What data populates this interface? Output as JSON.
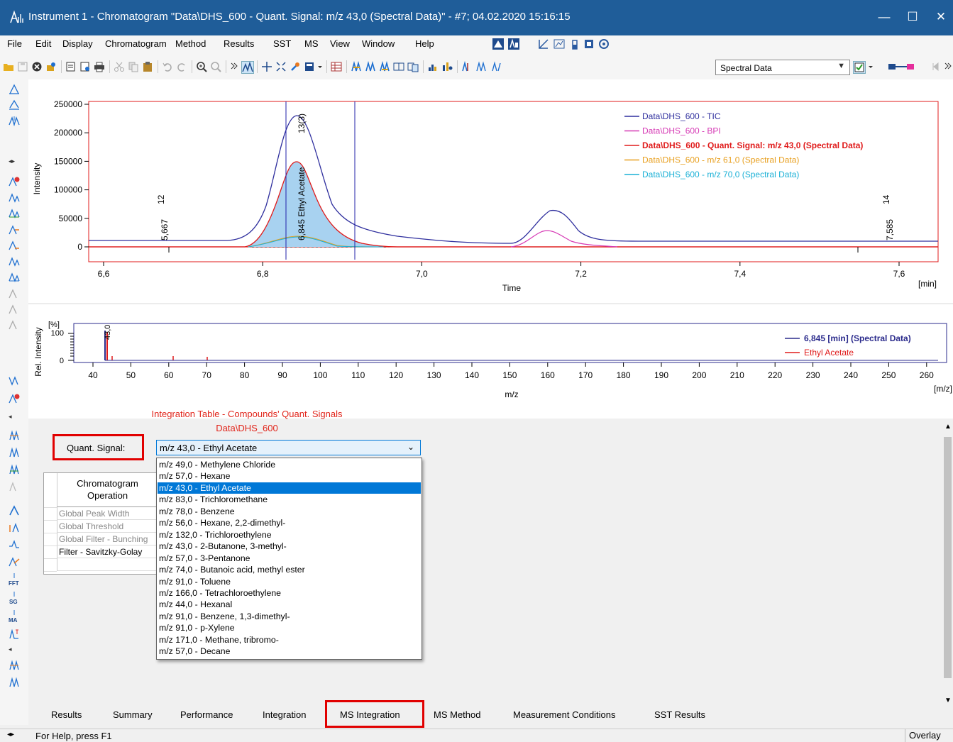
{
  "window": {
    "title": "Instrument 1 - Chromatogram \"Data\\DHS_600 - Quant. Signal: m/z 43,0 (Spectral Data)\" - #7;   04.02.2020   15:16:15",
    "minimize_glyph": "—",
    "maximize_glyph": "☐",
    "close_glyph": "✕"
  },
  "menu": [
    "File",
    "Edit",
    "Display",
    "Chromatogram",
    "Method",
    "Results",
    "SST",
    "MS",
    "View",
    "Window",
    "Help"
  ],
  "toolbar": {
    "spectral_combo": "Spectral Data"
  },
  "chromatogram": {
    "ylabel": "Intensity",
    "xlabel": "Time",
    "xunit": "[min]",
    "yticks": [
      "250000",
      "200000",
      "150000",
      "100000",
      "50000",
      "0"
    ],
    "xticks": [
      "6,6",
      "6,8",
      "7,0",
      "7,2",
      "7,4",
      "7,6"
    ],
    "peak_labels": [
      {
        "rt": "5,667",
        "num": "12"
      },
      {
        "rt": "6,845 Ethyl Acetate",
        "num": "13(3)"
      },
      {
        "rt": "7,585",
        "num": "14"
      }
    ],
    "legend": [
      {
        "label": "Data\\DHS_600 - TIC",
        "color": "#2f2f9e",
        "bold": false
      },
      {
        "label": "Data\\DHS_600 - BPI",
        "color": "#d63ab5",
        "bold": false
      },
      {
        "label": "Data\\DHS_600 - Quant. Signal: m/z 43,0 (Spectral Data)",
        "color": "#e01b1b",
        "bold": true
      },
      {
        "label": "Data\\DHS_600 - m/z 61,0 (Spectral Data)",
        "color": "#e8a020",
        "bold": false
      },
      {
        "label": "Data\\DHS_600 - m/z 70,0 (Spectral Data)",
        "color": "#1ab0d6",
        "bold": false
      }
    ]
  },
  "spectrum": {
    "ylabel": "Rel. Intensity",
    "yunit": "[%]",
    "yticks": [
      "100",
      "0"
    ],
    "xlabel": "m/z",
    "xunit": "[m/z]",
    "xticks": [
      "40",
      "50",
      "60",
      "70",
      "80",
      "90",
      "100",
      "110",
      "120",
      "130",
      "140",
      "150",
      "160",
      "170",
      "180",
      "190",
      "200",
      "210",
      "220",
      "230",
      "240",
      "250",
      "260"
    ],
    "peak_label": "43,0",
    "legend": [
      {
        "label": "6,845 [min] (Spectral Data)",
        "color": "#2b2b8c",
        "bold": true
      },
      {
        "label": "Ethyl Acetate",
        "color": "#e01b1b",
        "bold": false
      }
    ]
  },
  "integration": {
    "title_line1": "Integration Table - Compounds' Quant. Signals",
    "title_line2": "Data\\DHS_600",
    "quant_label": "Quant. Signal:",
    "quant_value": "m/z 43,0 - Ethyl Acetate",
    "table_header": "Chromatogram Operation",
    "rows": [
      "Global Peak Width",
      "Global Threshold",
      "Global Filter - Bunching",
      "Filter - Savitzky-Golay",
      ""
    ],
    "options": [
      "m/z 49,0 - Methylene Chloride",
      "m/z 57,0 - Hexane",
      "m/z 43,0 - Ethyl Acetate",
      "m/z 83,0 - Trichloromethane",
      "m/z 78,0 - Benzene",
      "m/z 56,0 - Hexane, 2,2-dimethyl-",
      "m/z 132,0 - Trichloroethylene",
      "m/z 43,0 - 2-Butanone, 3-methyl-",
      "m/z 57,0 - 3-Pentanone",
      "m/z 74,0 - Butanoic acid, methyl ester",
      "m/z 91,0 - Toluene",
      "m/z 166,0 - Tetrachloroethylene",
      "m/z 44,0 - Hexanal",
      "m/z 91,0 - Benzene, 1,3-dimethyl-",
      "m/z 91,0 - p-Xylene",
      "m/z 171,0 - Methane, tribromo-",
      "m/z 57,0 - Decane"
    ],
    "selected_index": 2
  },
  "tabs": [
    "Results",
    "Summary",
    "Performance",
    "Integration",
    "MS Integration",
    "MS Method",
    "Measurement Conditions",
    "SST Results"
  ],
  "status": {
    "help": "For Help, press F1",
    "mode": "Overlay"
  },
  "colors": {
    "titlebar": "#1f5d99",
    "frame": "#e01b1b",
    "highlight": "#0078d7",
    "peak_fill": "#a8d2f0"
  }
}
